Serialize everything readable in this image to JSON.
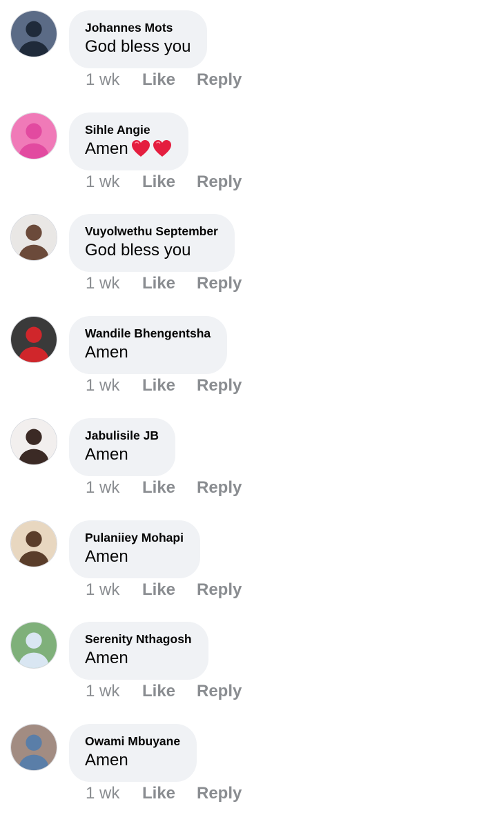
{
  "comments": [
    {
      "author": "Johannes Mots",
      "text": "God bless you",
      "time": "1 wk",
      "like_label": "Like",
      "reply_label": "Reply",
      "avatar_colors": [
        "#5b6b86",
        "#1f2a3a"
      ]
    },
    {
      "author": "Sihle Angie",
      "text": "Amen",
      "emoji": [
        "red-heart-icon",
        "red-heart-icon"
      ],
      "time": "1 wk",
      "like_label": "Like",
      "reply_label": "Reply",
      "avatar_colors": [
        "#f07ab8",
        "#e24aa0"
      ]
    },
    {
      "author": "Vuyolwethu September",
      "text": "God bless you",
      "time": "1 wk",
      "like_label": "Like",
      "reply_label": "Reply",
      "avatar_colors": [
        "#e9e7e5",
        "#6b4a3a"
      ]
    },
    {
      "author": "Wandile Bhengentsha",
      "text": "Amen",
      "time": "1 wk",
      "like_label": "Like",
      "reply_label": "Reply",
      "avatar_colors": [
        "#3a3a3a",
        "#d0262b"
      ]
    },
    {
      "author": "Jabulisile JB",
      "text": "Amen",
      "time": "1 wk",
      "like_label": "Like",
      "reply_label": "Reply",
      "avatar_colors": [
        "#f2efee",
        "#3b2a25"
      ]
    },
    {
      "author": "Pulaniiey Mohapi",
      "text": "Amen",
      "time": "1 wk",
      "like_label": "Like",
      "reply_label": "Reply",
      "avatar_colors": [
        "#e8d7c0",
        "#5a3d2a"
      ]
    },
    {
      "author": "Serenity Nthagosh",
      "text": "Amen",
      "time": "1 wk",
      "like_label": "Like",
      "reply_label": "Reply",
      "avatar_colors": [
        "#7fb07a",
        "#d9e6f2"
      ]
    },
    {
      "author": "Owami Mbuyane",
      "text": "Amen",
      "time": "1 wk",
      "like_label": "Like",
      "reply_label": "Reply",
      "avatar_colors": [
        "#a28c82",
        "#5a7ea8"
      ]
    }
  ],
  "colors": {
    "bubble_bg": "#f0f2f5",
    "meta_text": "#8a8d91",
    "author_text": "#050505",
    "heart": "#e41e3f"
  }
}
